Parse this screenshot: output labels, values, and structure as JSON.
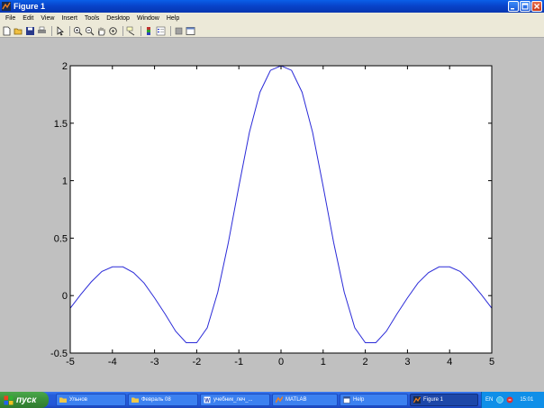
{
  "window": {
    "title": "Figure 1",
    "buttons": [
      "minimize-icon",
      "maximize-icon",
      "close-icon"
    ]
  },
  "menu": [
    "File",
    "Edit",
    "View",
    "Insert",
    "Tools",
    "Desktop",
    "Window",
    "Help"
  ],
  "toolbar_icons": [
    "new-figure-icon",
    "open-file-icon",
    "save-icon",
    "print-icon",
    "select-arrow-icon",
    "zoom-in-icon",
    "zoom-out-icon",
    "pan-hand-icon",
    "rotate-3d-icon",
    "data-cursor-icon",
    "colorbar-icon",
    "legend-icon",
    "hide-plot-tools-icon",
    "show-plot-tools-icon"
  ],
  "colors": {
    "line": "#2b2bd8",
    "axes_bg": "#ffffff",
    "figure_bg": "#c0c0c0",
    "taskbar": "#245edb",
    "start": "#3a8f3a"
  },
  "chart_data": {
    "type": "line",
    "title": "",
    "xlabel": "",
    "ylabel": "",
    "xlim": [
      -5,
      5
    ],
    "ylim": [
      -0.5,
      2
    ],
    "xticks": [
      -5,
      -4,
      -3,
      -2,
      -1,
      0,
      1,
      2,
      3,
      4,
      5
    ],
    "yticks": [
      -0.5,
      0,
      0.5,
      1,
      1.5,
      2
    ],
    "xtick_labels": [
      "-5",
      "-4",
      "-3",
      "-2",
      "-1",
      "0",
      "1",
      "2",
      "3",
      "4",
      "5"
    ],
    "ytick_labels": [
      "-0.5",
      "0",
      "0.5",
      "1",
      "1.5",
      "2"
    ],
    "grid": false,
    "series": [
      {
        "x": [
          -5,
          -4.75,
          -4.5,
          -4.25,
          -4,
          -3.75,
          -3.5,
          -3.25,
          -3,
          -2.75,
          -2.5,
          -2.25,
          -2,
          -1.75,
          -1.5,
          -1.25,
          -1,
          -0.75,
          -0.5,
          -0.25,
          0,
          0.25,
          0.5,
          0.75,
          1,
          1.25,
          1.5,
          1.75,
          2,
          2.25,
          2.5,
          2.75,
          3,
          3.25,
          3.5,
          3.75,
          4,
          4.25,
          4.5,
          4.75,
          5
        ],
        "y": [
          -0.11,
          0.01,
          0.12,
          0.21,
          0.25,
          0.25,
          0.2,
          0.11,
          -0.02,
          -0.16,
          -0.31,
          -0.41,
          -0.41,
          -0.28,
          0.03,
          0.46,
          0.95,
          1.42,
          1.77,
          1.96,
          2,
          1.96,
          1.77,
          1.42,
          0.95,
          0.46,
          0.03,
          -0.28,
          -0.41,
          -0.41,
          -0.31,
          -0.16,
          -0.02,
          0.11,
          0.2,
          0.25,
          0.25,
          0.21,
          0.12,
          0.01,
          -0.11
        ]
      }
    ]
  },
  "taskbar": {
    "start_label": "пуск",
    "tasks": [
      {
        "label": "Ульнов",
        "icon": "folder-icon",
        "active": false
      },
      {
        "label": "Февраль 08",
        "icon": "folder-icon",
        "active": false
      },
      {
        "label": "учебник_леч_...",
        "icon": "word-document-icon",
        "active": false
      },
      {
        "label": "MATLAB",
        "icon": "matlab-icon",
        "active": false
      },
      {
        "label": "Help",
        "icon": "help-window-icon",
        "active": false
      },
      {
        "label": "Figure 1",
        "icon": "matlab-figure-icon",
        "active": true
      }
    ],
    "tray": {
      "language": "EN",
      "icons": [
        "network-icon",
        "volume-icon"
      ],
      "clock": "15:01"
    }
  }
}
